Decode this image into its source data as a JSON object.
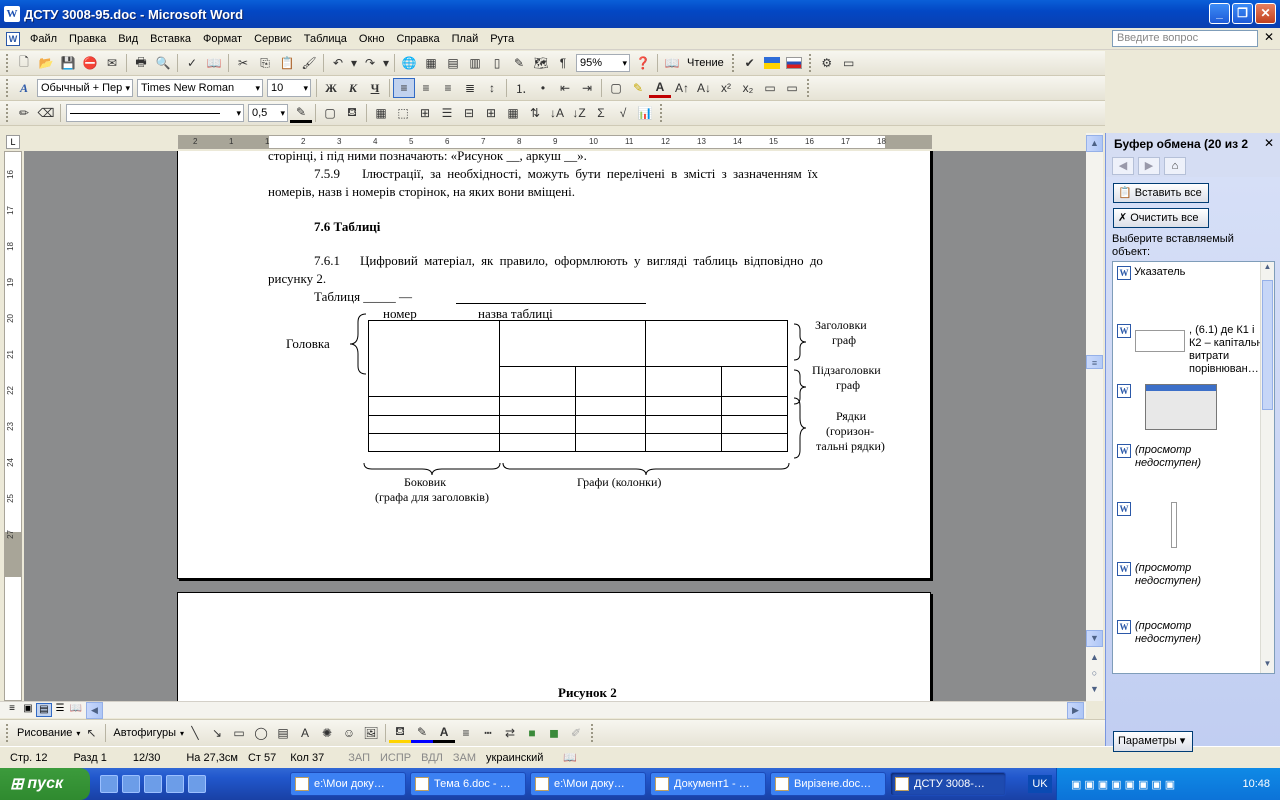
{
  "window": {
    "title": "ДСТУ 3008-95.doc - Microsoft Word",
    "app_icon": "W"
  },
  "menu": {
    "items": [
      "Файл",
      "Правка",
      "Вид",
      "Вставка",
      "Формат",
      "Сервис",
      "Таблица",
      "Окно",
      "Справка",
      "Плай",
      "Рута"
    ],
    "ask_placeholder": "Введите вопрос"
  },
  "toolbar": {
    "zoom": "95%",
    "reading_label": "Чтение",
    "style": "Обычный + Пер",
    "font": "Times New Roman",
    "size": "10",
    "bold": "Ж",
    "italic": "К",
    "underline": "Ч",
    "line_weight": "0,5"
  },
  "ruler": {
    "h_ticks": [
      "2",
      "1",
      "1",
      "2",
      "3",
      "4",
      "5",
      "6",
      "7",
      "8",
      "9",
      "10",
      "11",
      "12",
      "13",
      "14",
      "15",
      "16",
      "17",
      "18"
    ],
    "v_ticks": [
      "16",
      "17",
      "18",
      "19",
      "20",
      "21",
      "22",
      "23",
      "24",
      "25",
      "27"
    ]
  },
  "document": {
    "line0": "сторінці, і під ними позначають: «Рисунок __, аркуш __».",
    "para_759_num": "7.5.9",
    "para_759_line1": "Ілюстрації, за необхідності, можуть бути перелічені в змісті з зазначенням їх",
    "para_759_line2": "номерів, назв і номерів сторінок, на яких вони вміщені.",
    "heading_76": "7.6 Таблиці",
    "para_761_num": "7.6.1",
    "para_761_line1": "Цифровий матеріал, як правило, оформлюють у вигляді таблиць відповідно до",
    "para_761_line2": "рисунку 2.",
    "table_caption": "Таблиця _____ —",
    "caption_number": "номер",
    "caption_name": "назва таблиці",
    "label_head": "Головка",
    "label_col_headers_1": "Заголовки",
    "label_col_headers_2": "граф",
    "label_subheaders_1": "Підзаголовки",
    "label_subheaders_2": "граф",
    "label_rows_1": "Рядки",
    "label_rows_2": "(горизон-",
    "label_rows_3": "тальні рядки)",
    "label_stub_1": "Боковик",
    "label_stub_2": "(графа для заголовків)",
    "label_columns": "Графи (колонки)",
    "figure_caption": "Рисунок 2"
  },
  "drawing_bar": {
    "draw": "Рисование",
    "autoshapes": "Автофигуры"
  },
  "status": {
    "page": "Стр. 12",
    "section": "Разд 1",
    "pages": "12/30",
    "at": "На 27,3см",
    "line": "Ст 57",
    "col": "Кол 37",
    "rec": "ЗАП",
    "trk": "ИСПР",
    "ext": "ВДЛ",
    "ovr": "ЗАМ",
    "language": "украинский"
  },
  "taskpane": {
    "title": "Буфер обмена (20 из 2",
    "paste_all": "Вставить все",
    "clear_all": "Очистить все",
    "choose_label": "Выберите вставляемый объект:",
    "items": [
      "Указатель",
      ", (6.1) де К1 і К2 – капітальні витрати порівнюван…",
      "",
      "(просмотр недоступен)",
      "",
      "(просмотр недоступен)",
      "(просмотр недоступен)"
    ],
    "params": "Параметры"
  },
  "taskbar": {
    "start": "пуск",
    "tasks": [
      "е:\\Мои доку…",
      "Тема 6.doc - …",
      "е:\\Мои доку…",
      "Документ1 - …",
      "Вирізене.doc…",
      "ДСТУ 3008-…"
    ],
    "lang": "UK",
    "clock": "10:48"
  }
}
